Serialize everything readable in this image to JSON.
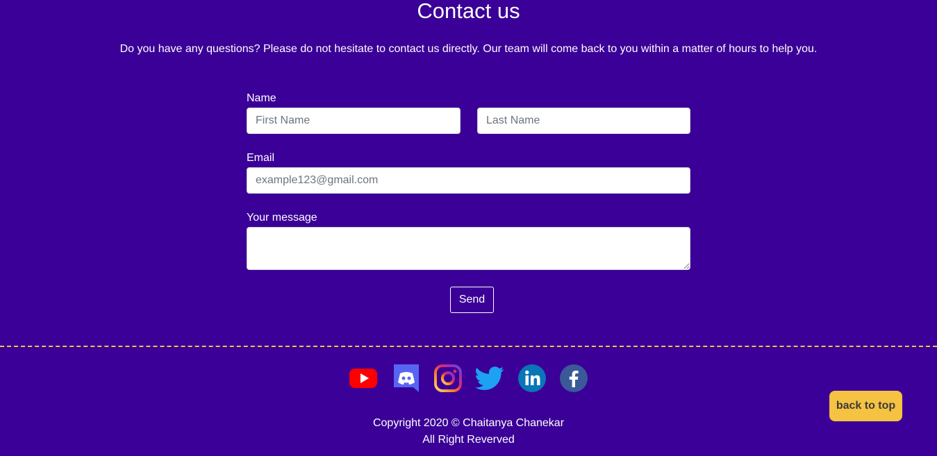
{
  "header": {
    "title": "Contact us",
    "intro": "Do you have any questions? Please do not hesitate to contact us directly. Our team will come back to you within a matter of hours to help you."
  },
  "form": {
    "name_label": "Name",
    "first_name_placeholder": "First Name",
    "last_name_placeholder": "Last Name",
    "email_label": "Email",
    "email_placeholder": "example123@gmail.com",
    "message_label": "Your message",
    "send_label": "Send"
  },
  "footer": {
    "social_icons": [
      "youtube-icon",
      "discord-icon",
      "instagram-icon",
      "twitter-icon",
      "linkedin-icon",
      "facebook-icon"
    ],
    "copyright_line1": "Copyright 2020 © Chaitanya Chanekar",
    "copyright_line2": "All Right Reverved",
    "back_to_top_label": "back to top"
  },
  "colors": {
    "background": "#3b0097",
    "divider": "#f5c242",
    "back_to_top_bg": "#f5c242"
  }
}
